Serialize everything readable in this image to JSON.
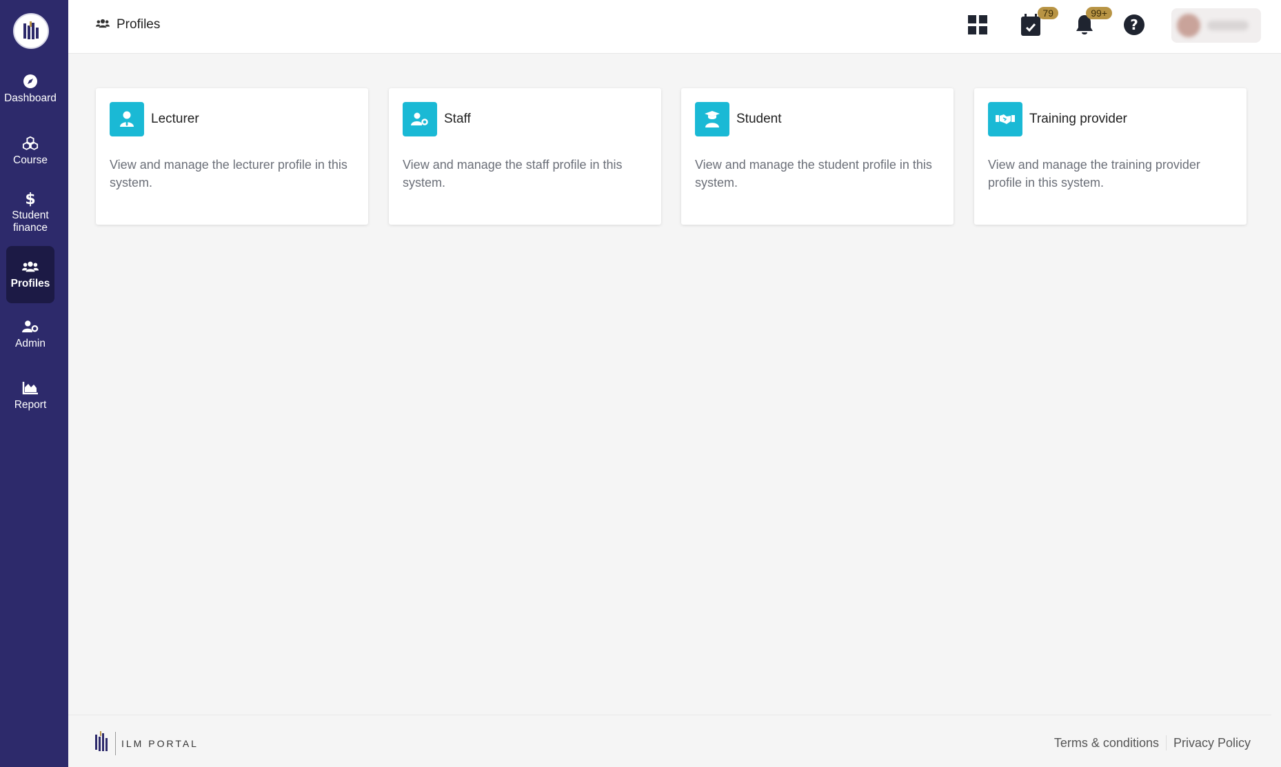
{
  "colors": {
    "sidebar_bg": "#2d2a6b",
    "sidebar_active_bg": "#1c1a45",
    "accent": "#1ab9d5",
    "badge_bg": "#b89444"
  },
  "sidebar": {
    "items": [
      {
        "label": "Dashboard",
        "icon": "compass-icon"
      },
      {
        "label": "Course",
        "icon": "cubes-icon"
      },
      {
        "label": "Student finance",
        "icon": "dollar-icon"
      },
      {
        "label": "Profiles",
        "icon": "users-icon",
        "active": true
      },
      {
        "label": "Admin",
        "icon": "user-gear-icon"
      },
      {
        "label": "Report",
        "icon": "area-chart-icon"
      }
    ]
  },
  "header": {
    "title": "Profiles",
    "tasks_badge": "79",
    "notifications_badge": "99+"
  },
  "cards": [
    {
      "title": "Lecturer",
      "description": "View and manage the lecturer profile in this system.",
      "icon": "user-tie-icon"
    },
    {
      "title": "Staff",
      "description": "View and manage the staff profile in this system.",
      "icon": "user-gear-icon"
    },
    {
      "title": "Student",
      "description": "View and manage the student profile in this system.",
      "icon": "graduate-icon"
    },
    {
      "title": "Training provider",
      "description": "View and manage the training provider profile in this system.",
      "icon": "handshake-icon"
    }
  ],
  "footer": {
    "brand": "ILM PORTAL",
    "terms": "Terms & conditions",
    "privacy": "Privacy Policy"
  }
}
